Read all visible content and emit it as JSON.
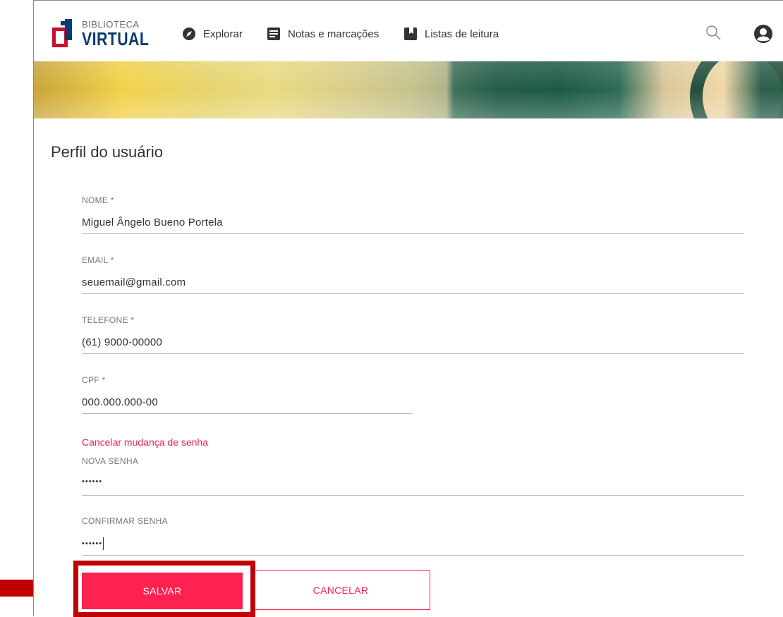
{
  "logo": {
    "line1": "BIBLIOTECA",
    "line2": "VIRTUAL"
  },
  "nav": {
    "explore": {
      "label": "Explorar",
      "icon": "compass-icon"
    },
    "notes": {
      "label": "Notas e marcações",
      "icon": "notes-icon"
    },
    "reading_lists": {
      "label": "Listas de leitura",
      "icon": "bookmark-icon"
    }
  },
  "header_icons": {
    "search": "search-icon",
    "user": "user-account-icon"
  },
  "page": {
    "title": "Perfil do usuário"
  },
  "form": {
    "name": {
      "label": "NOME *",
      "value": "Miguel Ângelo Bueno Portela"
    },
    "email": {
      "label": "EMAIL *",
      "value": "seuemail@gmail.com"
    },
    "phone": {
      "label": "TELEFONE *",
      "value": "(61) 9000-00000"
    },
    "cpf": {
      "label": "CPF *",
      "value": "000.000.000-00"
    },
    "cancel_password_change": "Cancelar mudança de senha",
    "new_password": {
      "label": "NOVA SENHA",
      "value": "••••••"
    },
    "confirm_password": {
      "label": "CONFIRMAR SENHA",
      "value": "••••••"
    }
  },
  "buttons": {
    "save": "SALVAR",
    "cancel": "CANCELAR"
  },
  "colors": {
    "accent": "#ff2250",
    "logo_blue": "#0a3a70",
    "logo_red": "#c8102e",
    "annotation": "#c00000"
  }
}
